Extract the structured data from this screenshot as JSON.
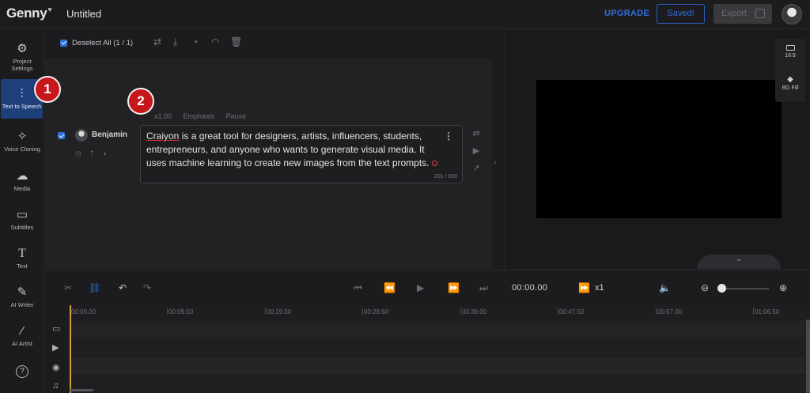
{
  "header": {
    "logo": "Genny",
    "logo_mark": "♥",
    "title": "Untitled",
    "upgrade": "UPGRADE",
    "saved": "Saved!",
    "export": "Export"
  },
  "sidebar": {
    "items": [
      {
        "label": "Project Settings",
        "icon": "gear-icon"
      },
      {
        "label": "Text to Speech",
        "icon": "waveform-icon"
      },
      {
        "label": "Voice Cloning",
        "icon": "sparkle-icon"
      },
      {
        "label": "Media",
        "icon": "cloud-upload-icon"
      },
      {
        "label": "Subtitles",
        "icon": "subtitles-icon"
      },
      {
        "label": "Text",
        "icon": "text-icon"
      },
      {
        "label": "AI Writer",
        "icon": "pen-icon"
      },
      {
        "label": "AI Artist",
        "icon": "wand-icon"
      }
    ],
    "help": "?"
  },
  "editor": {
    "deselect": "Deselect All (1 / 1)",
    "speaker": "Benjamin",
    "text_head": {
      "speed": "x1.00",
      "emphasis": "Emphasis",
      "pause": "Pause"
    },
    "text_first_word": "Craiyon",
    "text_line1_rest": " is a great tool for designers, artists, influencers, students,",
    "text_line2": "entrepreneurs, and anyone who wants to generate visual media. It",
    "text_line3": "uses machine learning to create new images from the text prompts.",
    "char_count": "201 / 500",
    "more": "⋮"
  },
  "preview": {
    "ratio": "16:9",
    "bg_fill": "BG Fill"
  },
  "playback": {
    "timecode": "00:00.00",
    "speed": "x1"
  },
  "timeline": {
    "ticks": [
      "00:00.00",
      "00:09.50",
      "00:19.00",
      "00:28.50",
      "00:38.00",
      "00:47.50",
      "00:57.00",
      "01:06.50"
    ]
  },
  "badges": {
    "one": "1",
    "two": "2"
  },
  "colors": {
    "accent": "#2f6fdc",
    "badge": "#c6171d",
    "playhead": "#d29a3f"
  }
}
